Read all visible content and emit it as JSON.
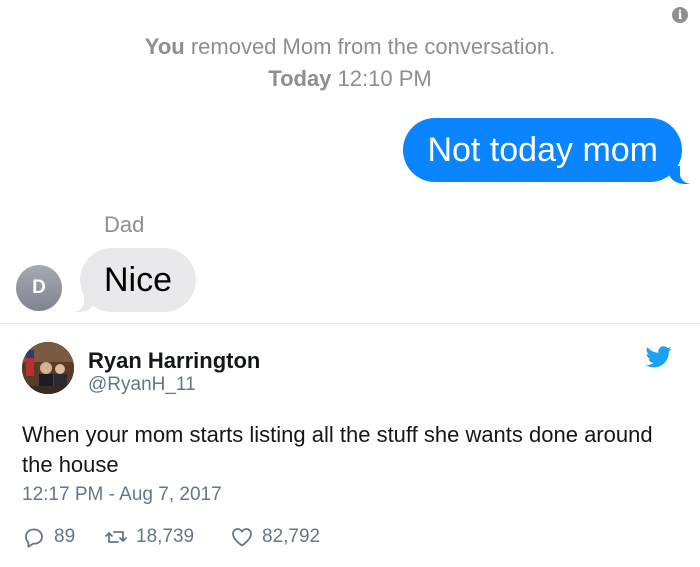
{
  "imessage": {
    "system_actor": "You",
    "system_action": "removed Mom from the conversation.",
    "system_day": "Today",
    "system_time": "12:10 PM",
    "outgoing_message": "Not today mom",
    "incoming_sender": "Dad",
    "avatar_initial": "D",
    "incoming_message": "Nice",
    "info_icon_glyph": "i",
    "outgoing_bubble_color": "#0a84ff",
    "incoming_bubble_color": "#e9e9eb"
  },
  "tweet": {
    "author_name": "Ryan Harrington",
    "author_handle": "@RyanH_11",
    "text": "When your mom starts listing all the stuff she wants done around the house",
    "timestamp": "12:17 PM - Aug 7, 2017",
    "replies": "89",
    "retweets": "18,739",
    "likes": "82,792",
    "brand_color": "#1da1f2",
    "icons": [
      "twitter-bird-icon",
      "reply-icon",
      "retweet-icon",
      "heart-icon"
    ]
  }
}
